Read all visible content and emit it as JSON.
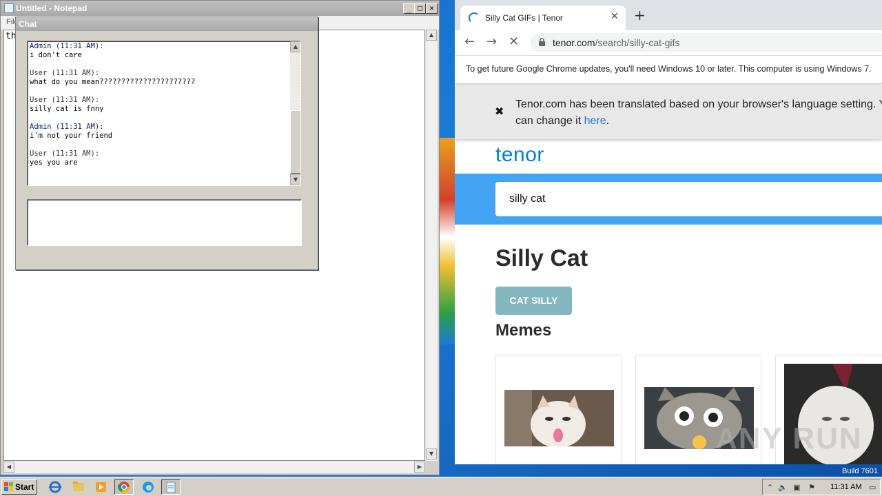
{
  "desktop": {
    "build_label": "Build 7601"
  },
  "notepad": {
    "title": "Untitled - Notepad",
    "menu_file": "File",
    "text": "th",
    "buttons": {
      "minimize": "_",
      "maximize": "□",
      "close": "✕"
    }
  },
  "chat": {
    "title": "Chat",
    "messages": [
      {
        "head": "Admin (11:31 AM):",
        "body": "i don't care"
      },
      {
        "head": "User (11:31 AM):",
        "body": "what do you mean??????????????????????"
      },
      {
        "head": "User (11:31 AM):",
        "body": "silly cat is fnny"
      },
      {
        "head": "Admin (11:31 AM):",
        "body": "i'm not your friend"
      },
      {
        "head": "User (11:31 AM):",
        "body": "yes you are"
      }
    ],
    "input_value": ""
  },
  "browser": {
    "tab_title": "Silly Cat GIFs | Tenor",
    "tab_close": "✕",
    "new_tab": "+",
    "url_host": "tenor.com",
    "url_path": "/search/silly-cat-gifs",
    "infobar": "To get future Google Chrome updates, you'll need Windows 10 or later. This computer is using Windows 7."
  },
  "page": {
    "translate_text": "Tenor.com has been translated based on your browser's language setting. You can change it",
    "translate_link": "here",
    "translate_end": ".",
    "logo": "tenor",
    "search_value": "silly cat",
    "heading": "Silly Cat",
    "tag_button": "CAT SILLY",
    "section": "Memes"
  },
  "taskbar": {
    "start": "Start",
    "clock": "11:31 AM"
  },
  "watermark": "ANY RUN"
}
